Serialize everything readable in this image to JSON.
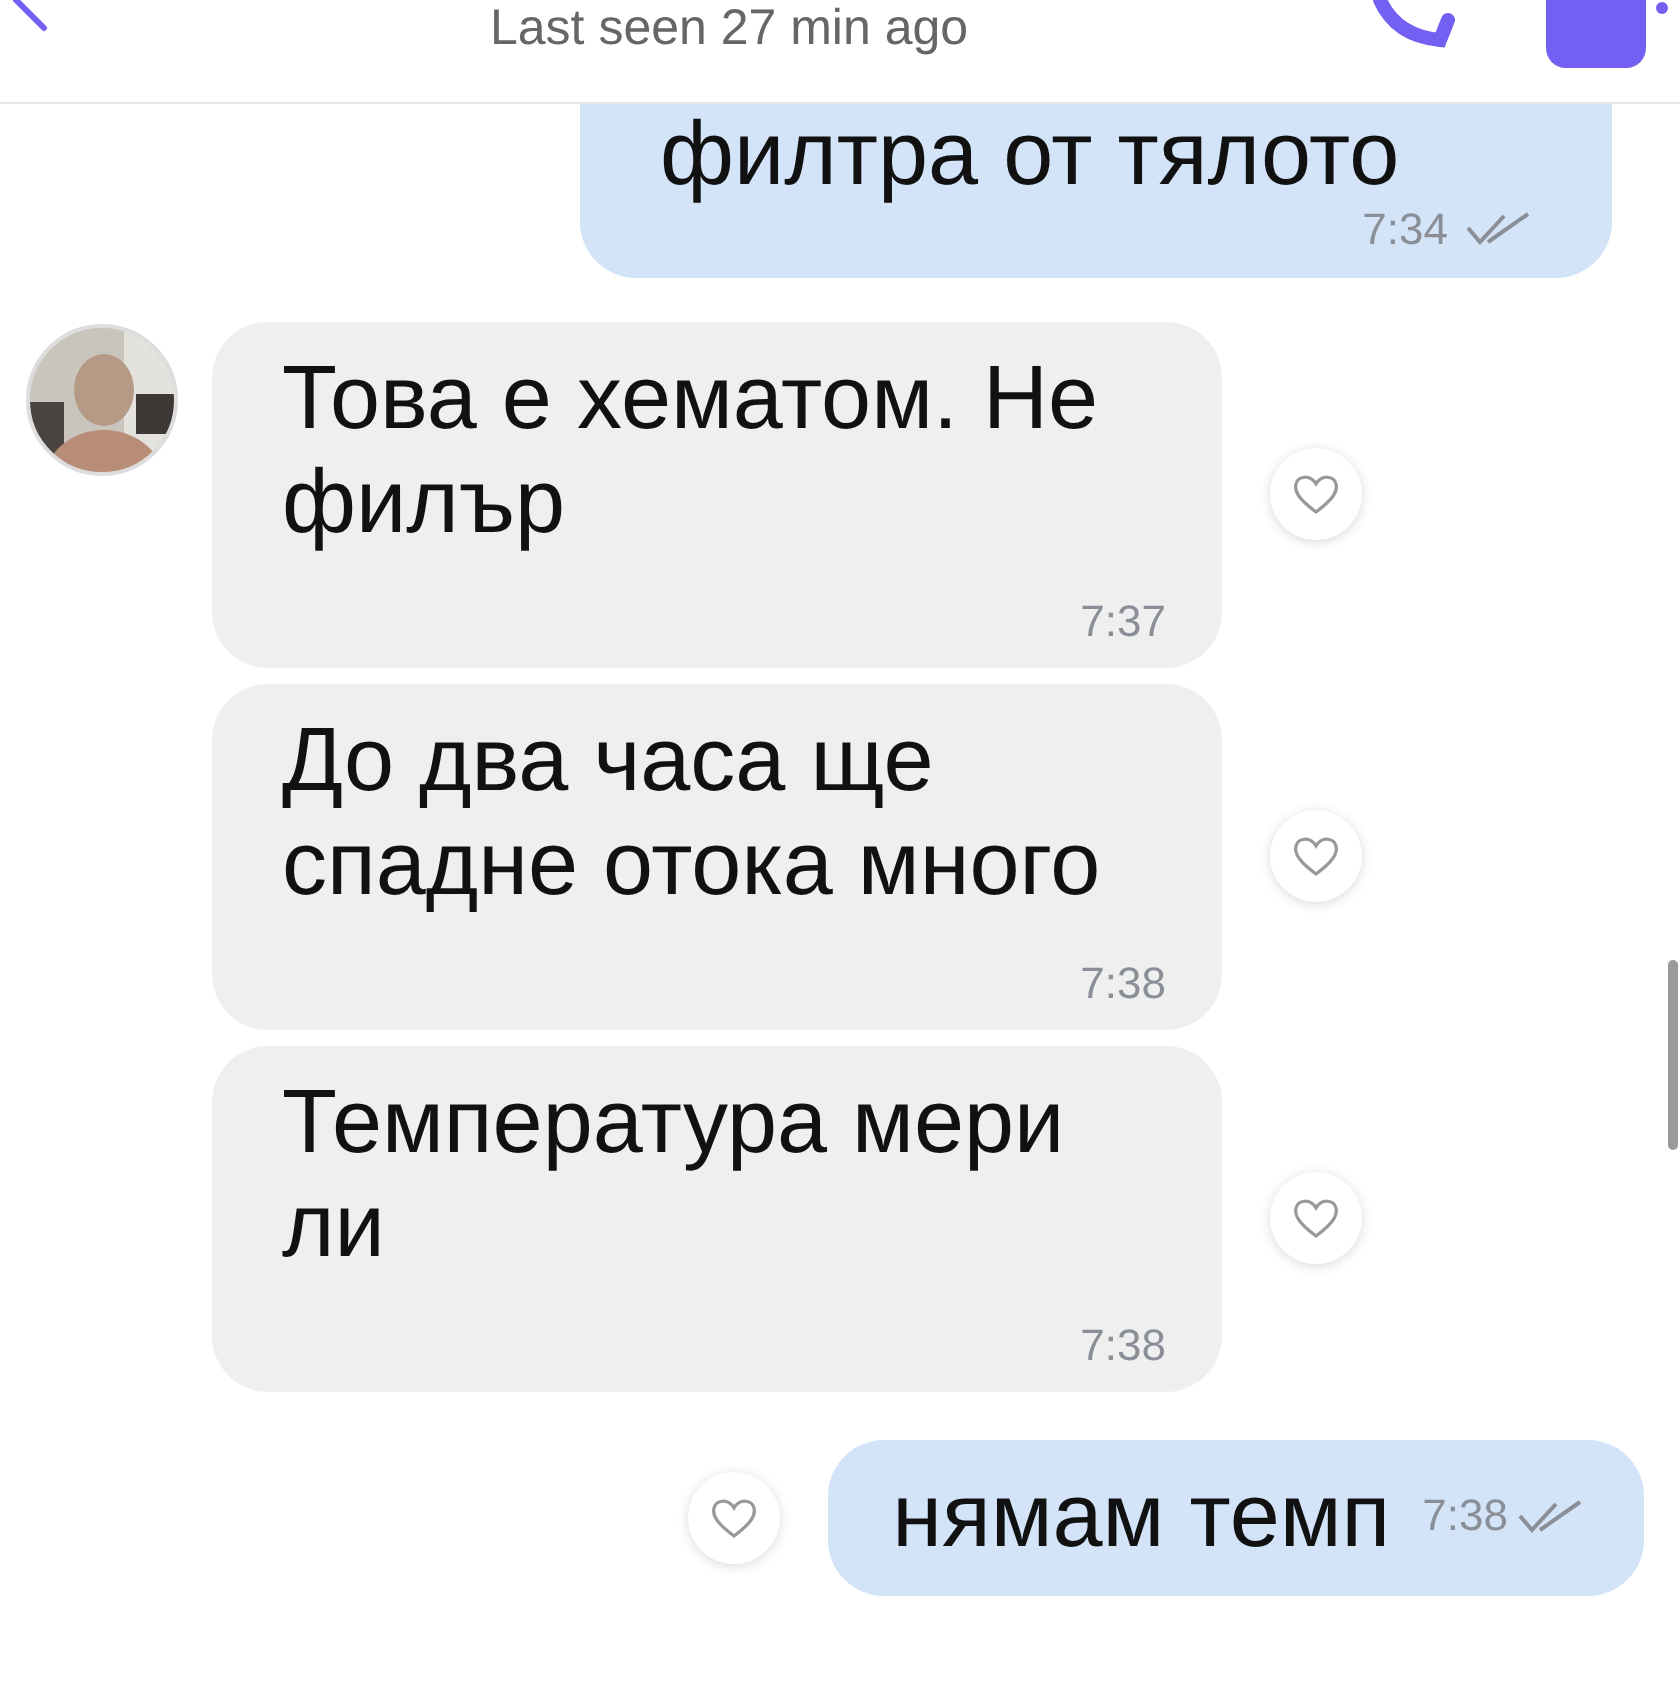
{
  "header": {
    "status": "Last seen 27 min ago"
  },
  "messages": [
    {
      "kind": "out",
      "text": "филтра от тялото",
      "time": "7:34",
      "read": true
    },
    {
      "kind": "in",
      "avatar": true,
      "text": "Това е хематом. Не филър",
      "time": "7:37"
    },
    {
      "kind": "in",
      "avatar": false,
      "text": "До два часа ще спадне отока много",
      "time": "7:38"
    },
    {
      "kind": "in",
      "avatar": false,
      "text": "Температура мери ли",
      "time": "7:38"
    },
    {
      "kind": "out",
      "text": "нямам темп",
      "time": "7:38",
      "read": true
    }
  ]
}
